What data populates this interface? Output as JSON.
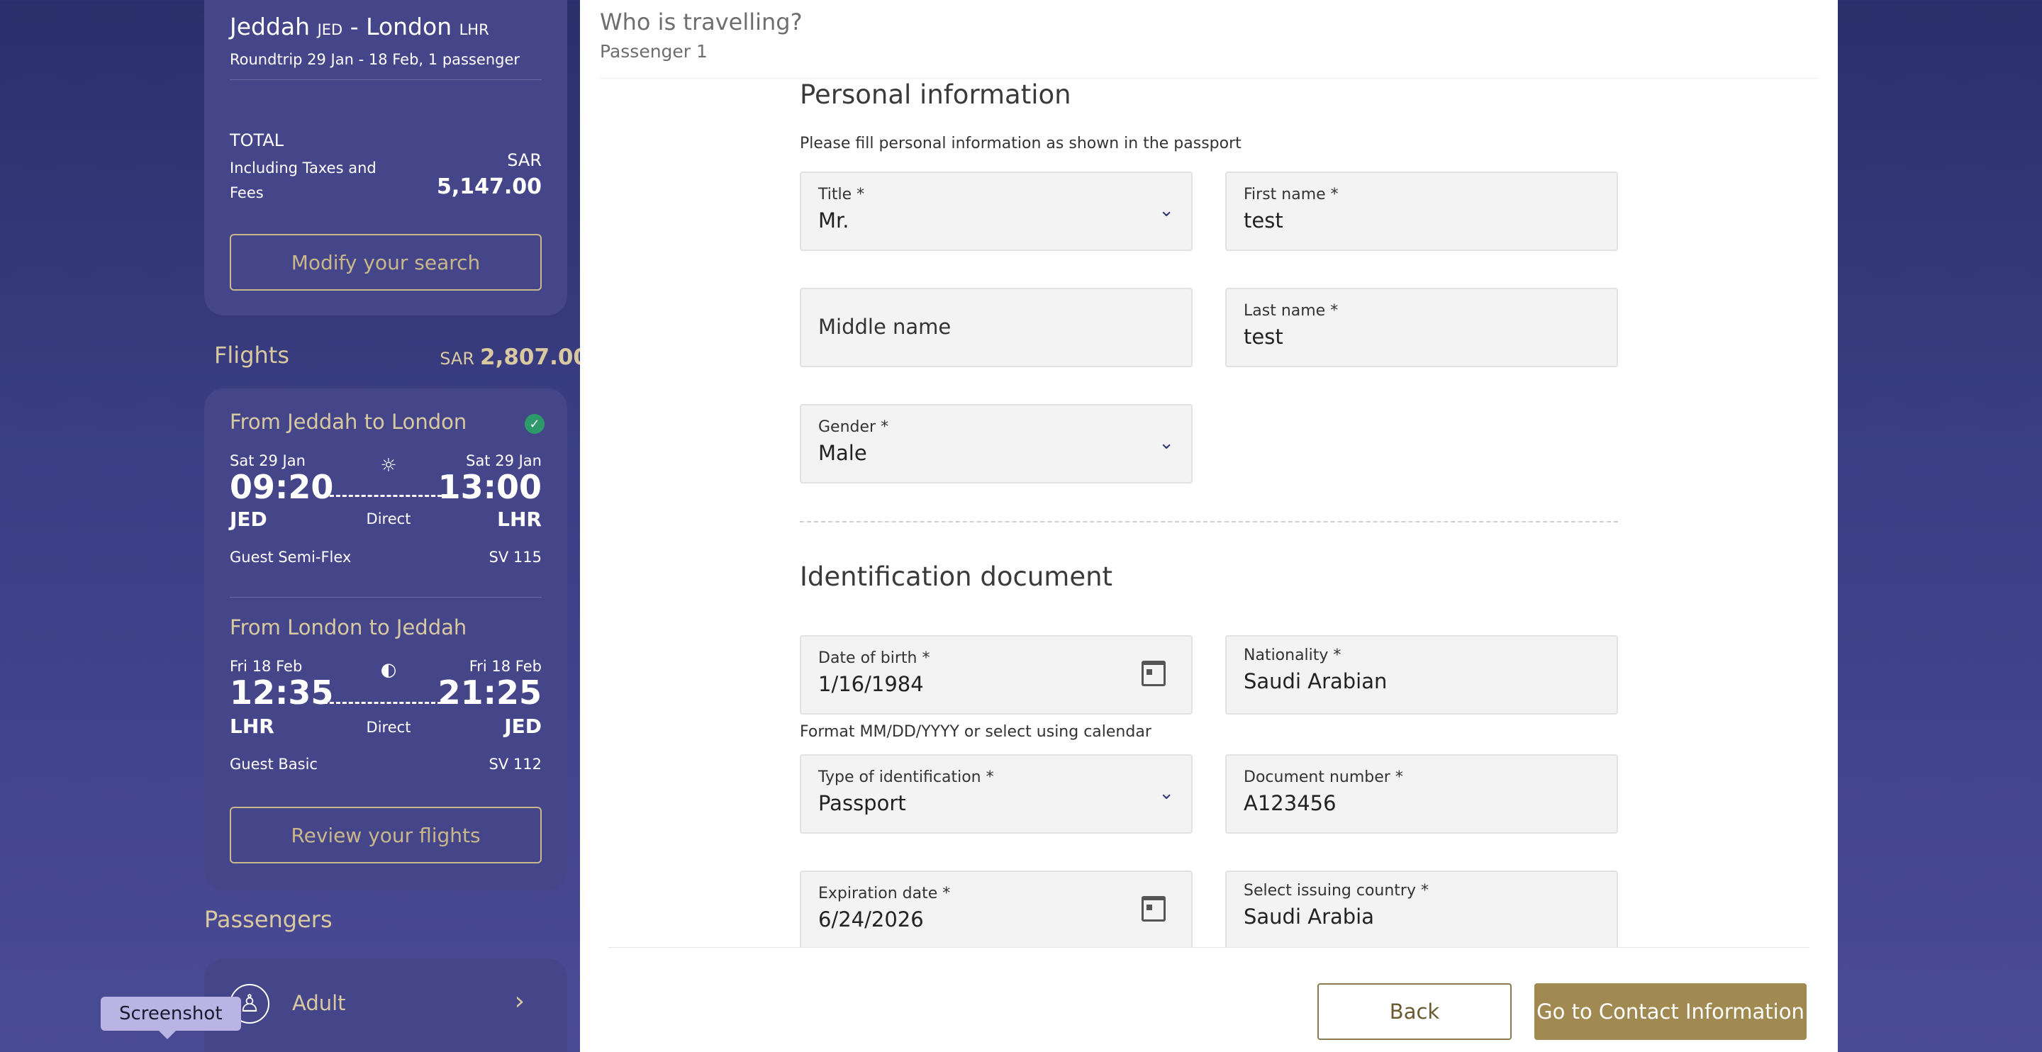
{
  "summary": {
    "origin": "Jeddah",
    "origin_code": "JED",
    "separator": "-",
    "destination": "London",
    "destination_code": "LHR",
    "trip_info": "Roundtrip 29 Jan - 18 Feb, 1 passenger",
    "total_label": "TOTAL",
    "total_desc": "Including Taxes and Fees",
    "total_currency": "SAR",
    "total_amount": "5,147.00",
    "modify_button": "Modify your search"
  },
  "flights": {
    "header": "Flights",
    "currency": "SAR",
    "amount": "2,807.00",
    "segments": [
      {
        "title": "From Jeddah to London",
        "dep_date": "Sat 29 Jan",
        "arr_date": "Sat 29 Jan",
        "dep_time": "09:20",
        "arr_time": "13:00",
        "dep_code": "JED",
        "arr_code": "LHR",
        "stops": "Direct",
        "fare": "Guest Semi-Flex",
        "flight_no": "SV 115",
        "icon": "sun-icon"
      },
      {
        "title": "From London to Jeddah",
        "dep_date": "Fri 18 Feb",
        "arr_date": "Fri 18 Feb",
        "dep_time": "12:35",
        "arr_time": "21:25",
        "dep_code": "LHR",
        "arr_code": "JED",
        "stops": "Direct",
        "fare": "Guest Basic",
        "flight_no": "SV 112",
        "icon": "sunset-icon"
      }
    ],
    "review_button": "Review your flights"
  },
  "passengers": {
    "header": "Passengers",
    "adult_label": "Adult"
  },
  "tooltip": "Screenshot",
  "form": {
    "title": "Who is travelling?",
    "subtitle": "Passenger 1",
    "personal": {
      "heading": "Personal information",
      "description": "Please fill personal information as shown in the passport",
      "title_label": "Title *",
      "title_value": "Mr.",
      "first_label": "First name *",
      "first_value": "test",
      "middle_placeholder": "Middle name",
      "last_label": "Last name *",
      "last_value": "test",
      "gender_label": "Gender *",
      "gender_value": "Male"
    },
    "identification": {
      "heading": "Identification document",
      "dob_label": "Date of birth *",
      "dob_value": "1/16/1984",
      "dob_helper": "Format MM/DD/YYYY or select using calendar",
      "nationality_label": "Nationality *",
      "nationality_value": "Saudi Arabian",
      "id_type_label": "Type of identification *",
      "id_type_value": "Passport",
      "doc_number_label": "Document number *",
      "doc_number_value": "A123456",
      "expiry_label": "Expiration date *",
      "expiry_value": "6/24/2026",
      "issuing_label": "Select issuing country *",
      "issuing_value": "Saudi Arabia"
    },
    "back_button": "Back",
    "next_button": "Go to Contact Information"
  }
}
